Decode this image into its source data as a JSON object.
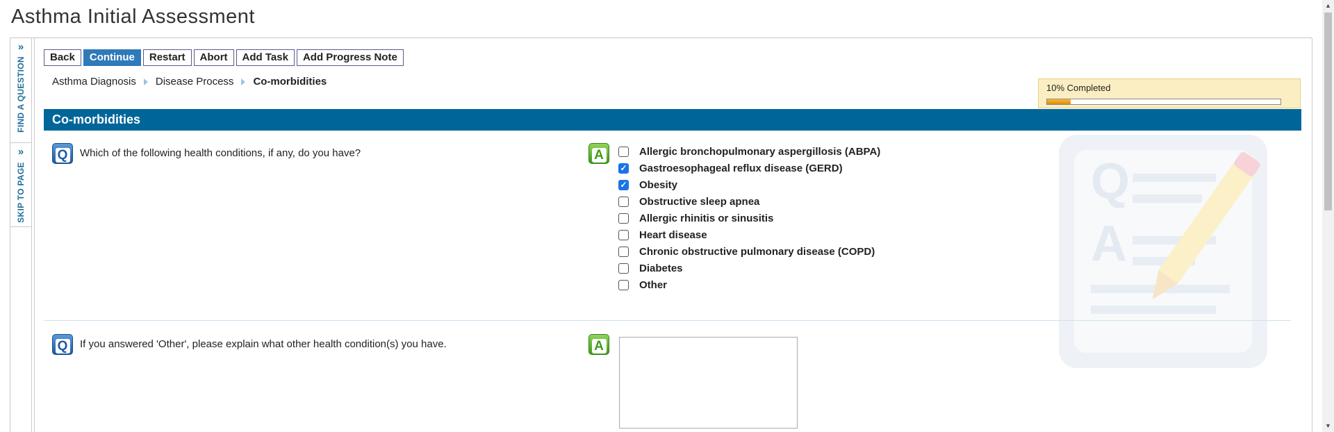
{
  "page": {
    "title": "Asthma Initial Assessment"
  },
  "side_tabs": {
    "find_question": {
      "chevron": "»",
      "label": "FIND A QUESTION"
    },
    "skip_to_page": {
      "chevron": "»",
      "label": "SKIP TO PAGE"
    }
  },
  "toolbar": {
    "back": "Back",
    "continue": "Continue",
    "restart": "Restart",
    "abort": "Abort",
    "add_task": "Add Task",
    "add_progress_note": "Add Progress Note"
  },
  "breadcrumb": {
    "items": [
      "Asthma Diagnosis",
      "Disease Process"
    ],
    "current": "Co-morbidities"
  },
  "progress": {
    "label": "10% Completed",
    "percent": 10
  },
  "section": {
    "title": "Co-morbidities"
  },
  "questions": [
    {
      "q_icon": "Q",
      "a_icon": "A",
      "text": "Which of the following health conditions, if any, do you have?",
      "options": [
        {
          "label": "Allergic bronchopulmonary aspergillosis (ABPA)",
          "checked": false
        },
        {
          "label": "Gastroesophageal reflux disease (GERD)",
          "checked": true
        },
        {
          "label": "Obesity",
          "checked": true
        },
        {
          "label": "Obstructive sleep apnea",
          "checked": false
        },
        {
          "label": "Allergic rhinitis or sinusitis",
          "checked": false
        },
        {
          "label": "Heart disease",
          "checked": false
        },
        {
          "label": "Chronic obstructive pulmonary disease (COPD)",
          "checked": false
        },
        {
          "label": "Diabetes",
          "checked": false
        },
        {
          "label": "Other",
          "checked": false
        }
      ]
    },
    {
      "q_icon": "Q",
      "a_icon": "A",
      "text": "If you answered 'Other', please explain what other health condition(s) you have.",
      "answer_value": ""
    }
  ],
  "icons": {
    "question": "question-icon",
    "answer": "answer-icon",
    "breadcrumb_separator": "chevron-right-icon",
    "check": "✓",
    "watermark": "qa-pencil-watermark-icon"
  },
  "colors": {
    "section_header": "#006699",
    "primary_button": "#2f7ab9",
    "progress_fill": "#f0a21a",
    "progress_box": "#fbeec2",
    "checkbox_checked": "#1a73e8"
  }
}
